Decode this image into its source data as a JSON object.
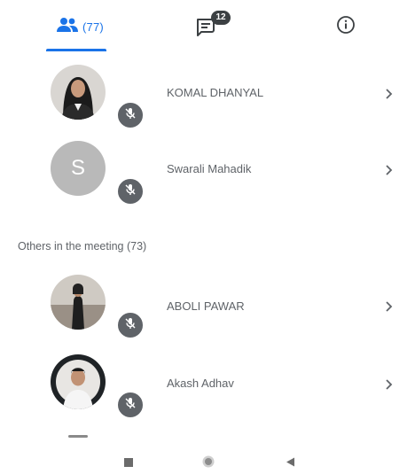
{
  "tabs": {
    "people": {
      "icon": "people-icon",
      "count_label": "(77)",
      "selected": true
    },
    "chat": {
      "icon": "chat-icon",
      "badge": "12"
    },
    "info": {
      "icon": "info-icon"
    }
  },
  "colors": {
    "accent": "#1a73e8",
    "text": "#5f6368",
    "mic_badge": "#5f6368",
    "avatar_letter_bg": "#b9b9b9"
  },
  "participants_pinned": [
    {
      "name": "KOMAL DHANYAL",
      "avatar": "photo",
      "mic": "mic-off-icon"
    },
    {
      "name": "Swarali Mahadik",
      "avatar_letter": "S",
      "mic": "mic-off-icon"
    }
  ],
  "others_header": "Others in the meeting (73)",
  "participants_others": [
    {
      "name": "ABOLI PAWAR",
      "avatar": "photo",
      "mic": "mic-off-icon"
    },
    {
      "name": "Akash Adhav",
      "avatar": "photo",
      "mic": "mic-off-icon"
    }
  ],
  "navbar": {
    "recents": "square-icon",
    "home": "circle-icon",
    "back": "triangle-back-icon"
  }
}
